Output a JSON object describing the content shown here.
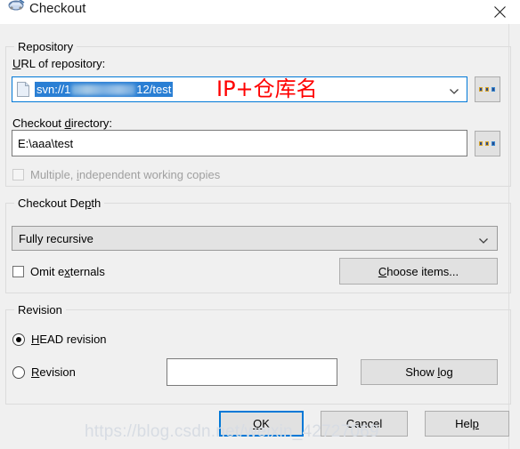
{
  "window": {
    "title": "Checkout",
    "icon": "tortoisesvn-checkout-icon",
    "close_label": "✕"
  },
  "repository": {
    "group_label": "Repository",
    "url_label_pre": "U",
    "url_label_post": "RL of repository:",
    "url_value_prefix": "svn://1",
    "url_value_suffix": "12/test",
    "url_blurred": true,
    "url_dropdown_icon": "chevron-down-icon",
    "browse_button_label": "...",
    "annotation": "IP+仓库名",
    "dir_label_pre": "Checkout ",
    "dir_label_acc": "d",
    "dir_label_post": "irectory:",
    "dir_value": "E:\\aaa\\test",
    "multiple_checkbox_pre": "Multiple, ",
    "multiple_checkbox_acc": "i",
    "multiple_checkbox_post": "ndependent working copies",
    "multiple_checked": false,
    "multiple_disabled": true
  },
  "depth": {
    "group_label_pre": "Checkout De",
    "group_label_acc": "p",
    "group_label_post": "th",
    "selected": "Fully recursive",
    "options": [
      "Fully recursive"
    ],
    "dropdown_icon": "chevron-down-icon",
    "omit_externals_pre": "Omit e",
    "omit_externals_acc": "x",
    "omit_externals_post": "ternals",
    "omit_externals_checked": false,
    "choose_items_pre": "",
    "choose_items_acc": "C",
    "choose_items_post": "hoose items..."
  },
  "revision": {
    "group_label": "Revision",
    "head_label_acc": "H",
    "head_label_post": "EAD revision",
    "head_selected": true,
    "rev_label_acc": "R",
    "rev_label_post": "evision",
    "rev_selected": false,
    "rev_value": "",
    "show_log_pre": "Show ",
    "show_log_acc": "l",
    "show_log_post": "og"
  },
  "footer": {
    "ok_acc": "O",
    "ok_post": "K",
    "cancel_label": "Cancel",
    "help_pre": "Hel",
    "help_acc": "p",
    "help_post": ""
  },
  "watermark": "https://blog.csdn.net/weixin_42727069",
  "colors": {
    "accent": "#0078d7",
    "selection": "#2a7fd4",
    "annotation_red": "#ff0000",
    "dialog_bg": "#f0f0f0",
    "button_bg": "#e1e1e1",
    "watermark": "#d7dce3"
  }
}
